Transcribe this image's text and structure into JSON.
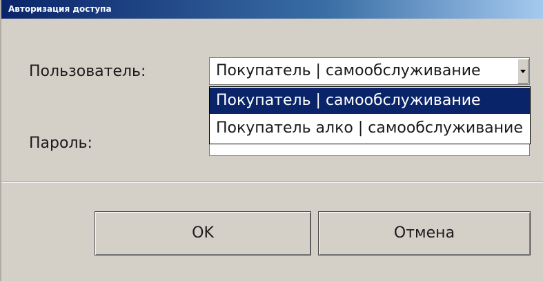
{
  "window": {
    "title": "Авторизация доступа"
  },
  "form": {
    "user_label": "Пользователь:",
    "password_label": "Пароль:",
    "user_selected": "Покупатель | самообслуживание",
    "password_value": ""
  },
  "dropdown": {
    "options": [
      "Покупатель | самообслуживание",
      "Покупатель алко | самообслуживание"
    ],
    "highlighted_index": 0
  },
  "buttons": {
    "ok_label": "OK",
    "cancel_label": "Отмена"
  },
  "colors": {
    "titlebar_start": "#0a246a",
    "titlebar_end": "#a6caf0",
    "selection": "#0a246a",
    "dialog_bg": "#d4d0c8"
  },
  "icons": {
    "combo_arrow": "chevron-down-icon"
  }
}
